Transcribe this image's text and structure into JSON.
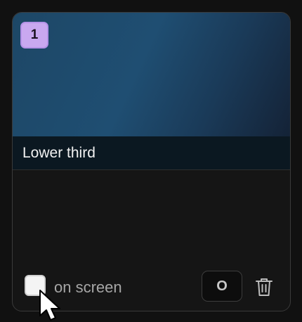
{
  "card": {
    "badge_number": "1",
    "title": "Lower third"
  },
  "footer": {
    "checkbox_label": "on screen",
    "checkbox_checked": false,
    "key_label": "O"
  },
  "icons": {
    "delete": "trash-icon",
    "cursor": "mouse-pointer-icon"
  },
  "colors": {
    "badge": "#c9a8f0",
    "preview_gradient_start": "#1d4766",
    "preview_gradient_end": "#142236",
    "card_background": "#151515"
  }
}
